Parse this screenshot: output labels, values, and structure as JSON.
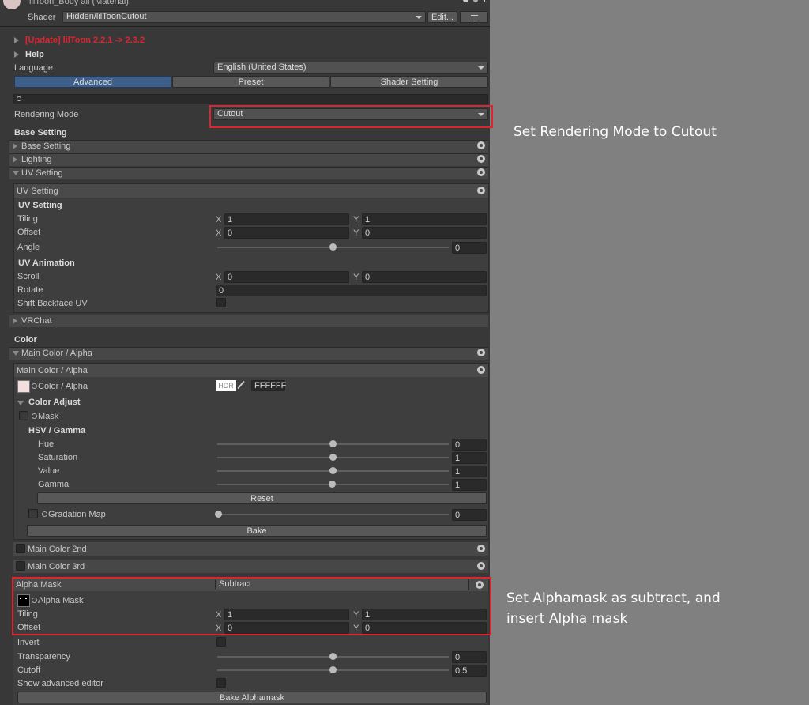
{
  "header": {
    "title": "lilToon_Body all (Material)",
    "shader_label": "Shader",
    "shader_value": "Hidden/lilToonCutout",
    "edit_label": "Edit..."
  },
  "update_notice": "[Update] lilToon 2.2.1 -> 2.3.2",
  "help": "Help",
  "language": {
    "label": "Language",
    "value": "English (United States)"
  },
  "tabs": [
    "Advanced",
    "Preset",
    "Shader Setting"
  ],
  "search_icon": "search-icon",
  "rendering_mode": {
    "label": "Rendering Mode",
    "value": "Cutout"
  },
  "base_setting_title": "Base Setting",
  "foldouts": {
    "base": "Base Setting",
    "lighting": "Lighting",
    "uv": "UV Setting",
    "vrchat": "VRChat",
    "main_color": "Main Color / Alpha"
  },
  "uv": {
    "box_title": "UV Setting",
    "section": "UV Setting",
    "tiling_label": "Tiling",
    "tiling_x": "1",
    "tiling_y": "1",
    "offset_label": "Offset",
    "offset_x": "0",
    "offset_y": "0",
    "angle_label": "Angle",
    "angle_value": "0",
    "angle_level": 0.5,
    "anim_title": "UV Animation",
    "scroll_label": "Scroll",
    "scroll_x": "0",
    "scroll_y": "0",
    "rotate_label": "Rotate",
    "rotate_value": "0",
    "shift_label": "Shift Backface UV",
    "x": "X",
    "y": "Y"
  },
  "color_title": "Color",
  "main_color": {
    "box_title": "Main Color / Alpha",
    "color_label": "Color / Alpha",
    "hdr": "HDR",
    "hex": "FFFFFF",
    "adjust_title": "Color Adjust",
    "mask_label": "Mask",
    "hsv_title": "HSV / Gamma",
    "hue_label": "Hue",
    "hue_value": "0",
    "sat_label": "Saturation",
    "sat_value": "1",
    "val_label": "Value",
    "val_value": "1",
    "gamma_label": "Gamma",
    "gamma_value": "1",
    "reset": "Reset",
    "gradation_label": "Gradation Map",
    "gradation_value": "0",
    "bake": "Bake"
  },
  "main_color_2nd": "Main Color 2nd",
  "main_color_3rd": "Main Color 3rd",
  "alpha_mask": {
    "label": "Alpha Mask",
    "mode": "Subtract",
    "tex_label": "Alpha Mask",
    "tiling_label": "Tiling",
    "tiling_x": "1",
    "tiling_y": "1",
    "offset_label": "Offset",
    "offset_x": "0",
    "offset_y": "0",
    "invert_label": "Invert",
    "transparency_label": "Transparency",
    "transparency_value": "0",
    "cutoff_label": "Cutoff",
    "cutoff_value": "0.5",
    "advanced_label": "Show advanced editor",
    "bake": "Bake Alphamask"
  },
  "annotations": {
    "rendering": "Set Rendering Mode to Cutout",
    "alpha_line1": "Set Alphamask as subtract, and",
    "alpha_line2": "insert Alpha mask"
  },
  "colors": {
    "accent_tab": "#3d5f8a",
    "update_red": "#e0242f",
    "panel": "#383838",
    "background": "#808080"
  }
}
